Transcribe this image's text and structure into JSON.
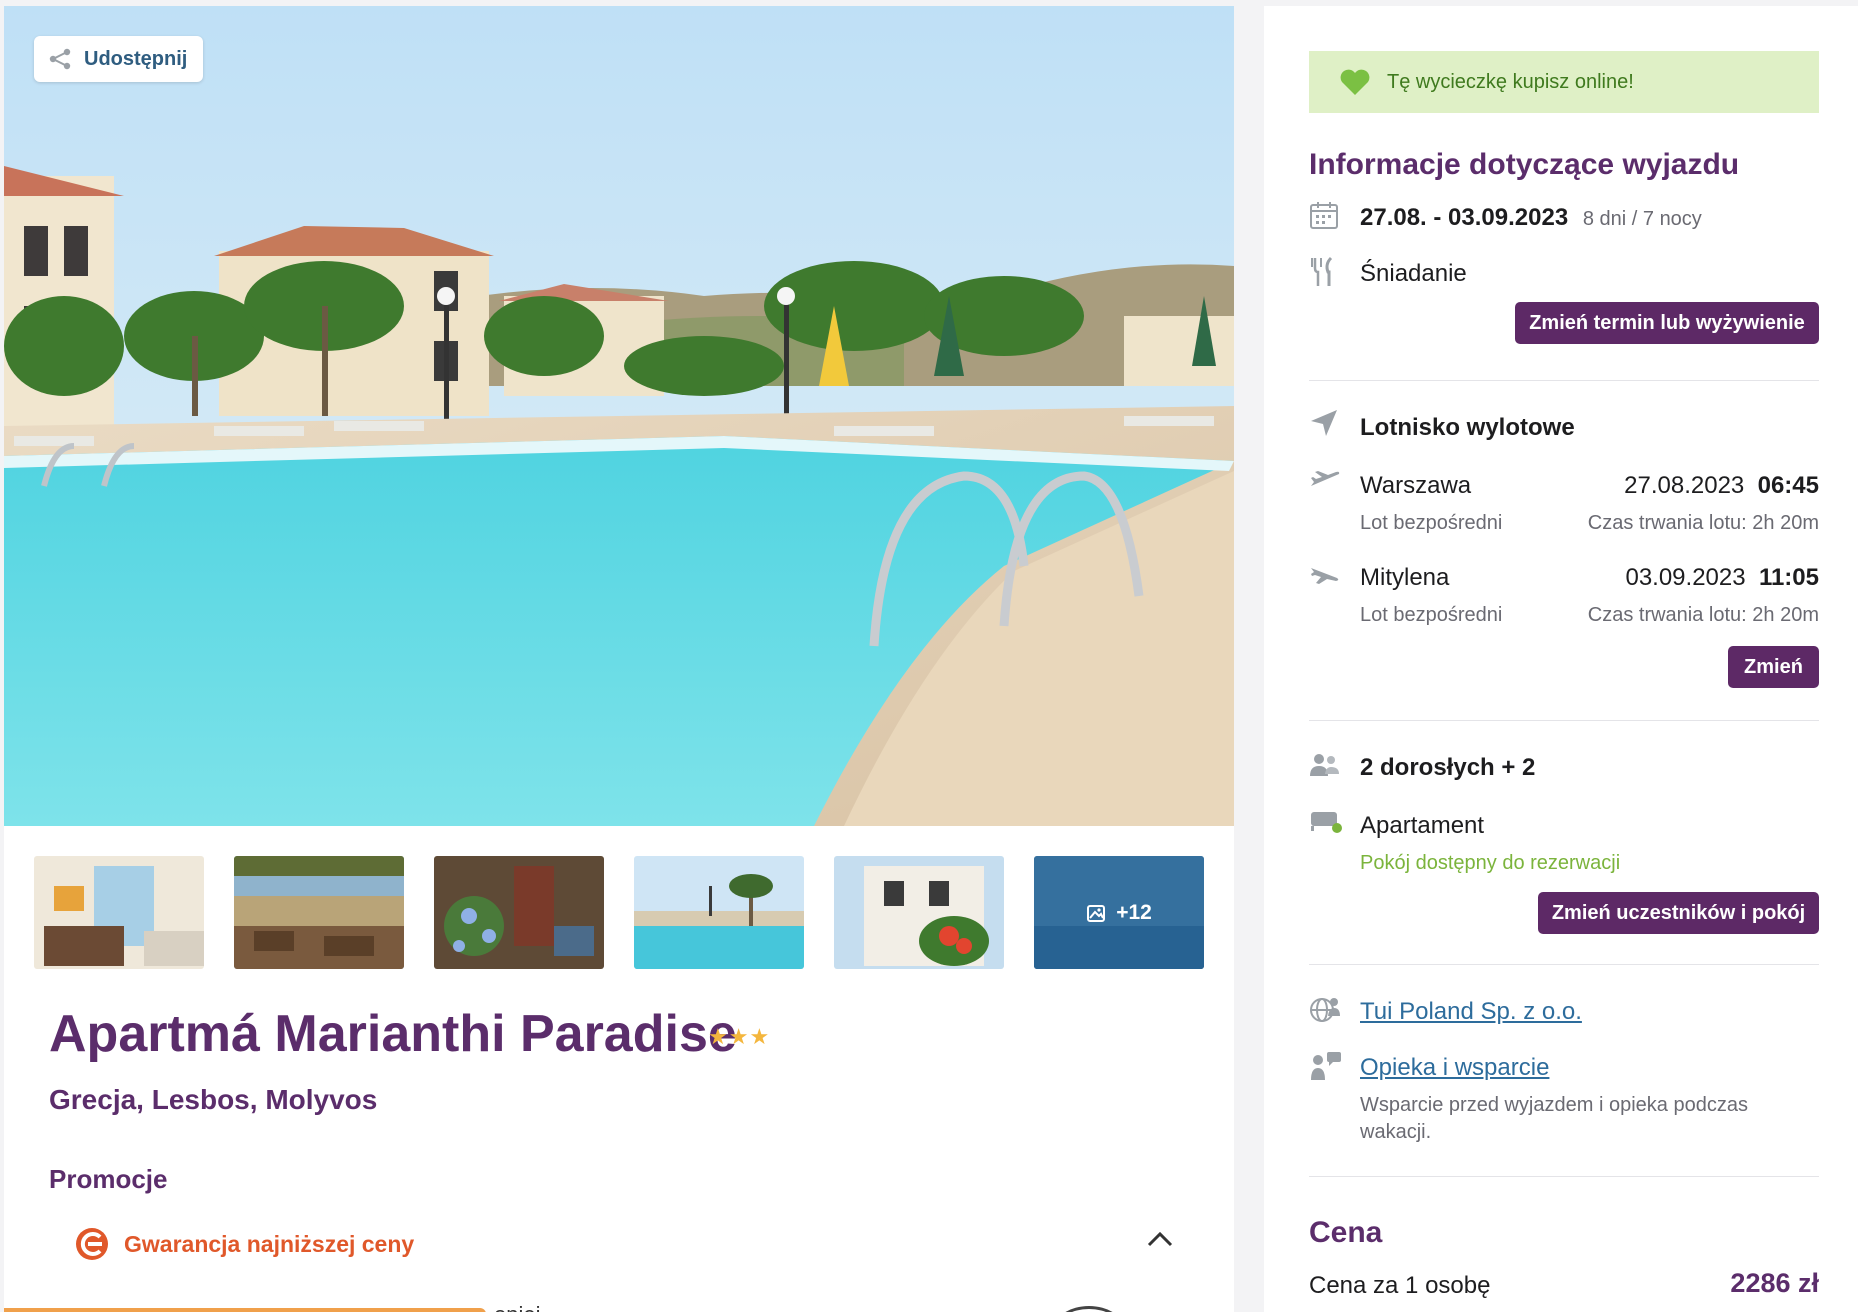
{
  "gallery": {
    "share_label": "Udostępnij",
    "more_photos_label": "+12"
  },
  "hotel": {
    "name": "Apartmá Marianthi Paradise",
    "stars": "★★★",
    "location": "Grecja, Lesbos, Molyvos"
  },
  "promotions": {
    "heading": "Promocje",
    "items": [
      "Gwarancja najniższej ceny"
    ],
    "peek_text": "opiej"
  },
  "sidebar": {
    "online_banner": "Tę wycieczkę kupisz online!",
    "trip_info_title": "Informacje dotyczące wyjazdu",
    "dates": "27.08. - 03.09.2023",
    "duration": "8 dni / 7 nocy",
    "board": "Śniadanie",
    "change_term_button": "Zmień termin lub wyżywienie",
    "departure_airport_label": "Lotnisko wylotowe",
    "flights": [
      {
        "city": "Warszawa",
        "date": "27.08.2023",
        "time": "06:45",
        "type": "Lot bezpośredni",
        "duration": "Czas trwania lotu: 2h 20m"
      },
      {
        "city": "Mitylena",
        "date": "03.09.2023",
        "time": "11:05",
        "type": "Lot bezpośredni",
        "duration": "Czas trwania lotu: 2h 20m"
      }
    ],
    "change_flight_button": "Zmień",
    "participants": "2 dorosłych + 2",
    "room_type": "Apartament",
    "room_status": "Pokój dostępny do rezerwacji",
    "change_participants_button": "Zmień uczestników i pokój",
    "organizer_link": "Tui Poland Sp. z o.o.",
    "support_link": "Opieka i wsparcie",
    "support_desc": "Wsparcie przed wyjazdem i opieka podczas wakacji.",
    "price_title": "Cena",
    "price_label": "Cena za 1 osobę",
    "price_value": "2286 zł"
  },
  "colors": {
    "brand_purple": "#5b2d6b",
    "button_purple": "#5d2966",
    "promo_orange": "#e0582a",
    "success_green": "#7bb43c",
    "banner_bg": "#dff0c6",
    "link_blue": "#2d6c9c"
  },
  "icons": {
    "share": "share-icon",
    "heart": "heart-icon",
    "calendar": "calendar-icon",
    "board": "fork-knife-icon",
    "airport": "navigation-arrow-icon",
    "takeoff": "plane-takeoff-icon",
    "landing": "plane-landing-icon",
    "people": "people-icon",
    "bed": "bed-icon",
    "organizer": "globe-person-icon",
    "support": "support-agent-icon",
    "promo": "price-guarantee-icon",
    "chevron": "chevron-up-icon",
    "gallery": "gallery-icon"
  }
}
